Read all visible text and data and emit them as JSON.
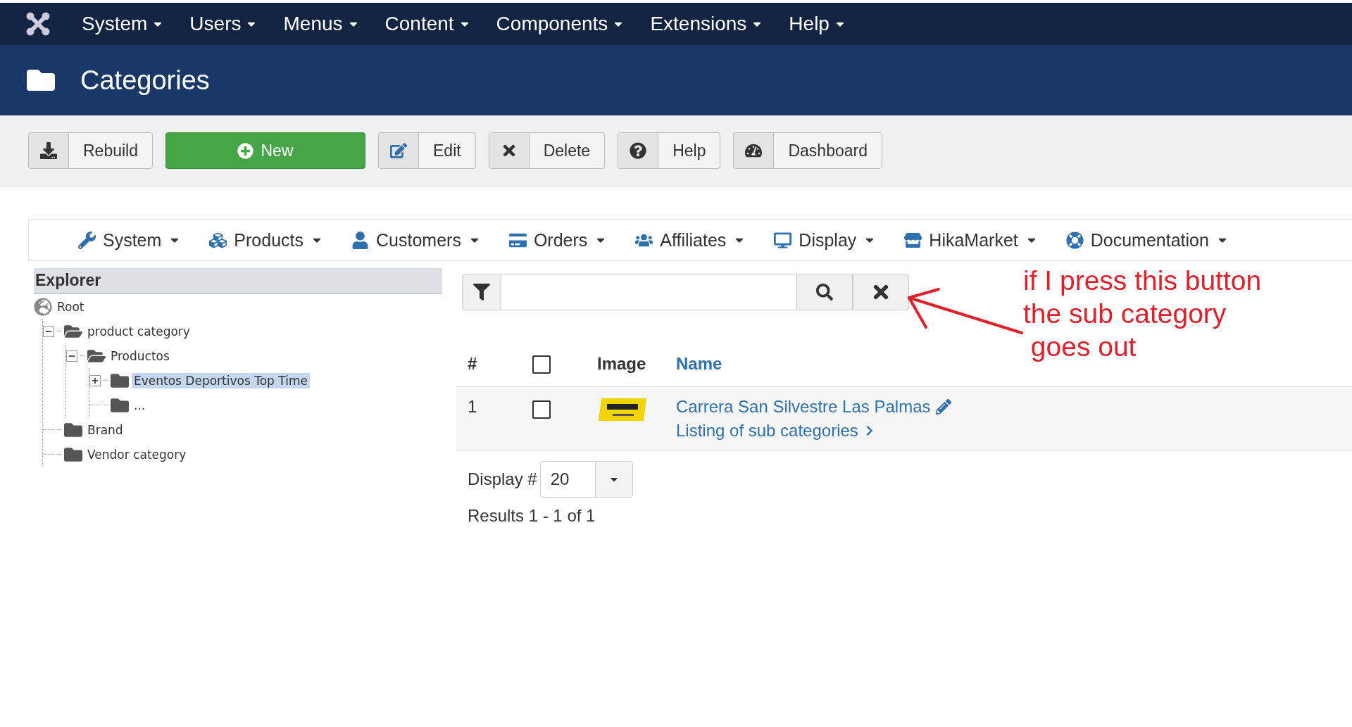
{
  "top_menu": {
    "items": [
      {
        "label": "System"
      },
      {
        "label": "Users"
      },
      {
        "label": "Menus"
      },
      {
        "label": "Content"
      },
      {
        "label": "Components"
      },
      {
        "label": "Extensions"
      },
      {
        "label": "Help"
      }
    ]
  },
  "header": {
    "title": "Categories"
  },
  "toolbar": {
    "buttons": [
      {
        "label": "Rebuild",
        "kind": "rebuild"
      },
      {
        "label": "New",
        "kind": "new"
      },
      {
        "label": "Edit",
        "kind": "edit"
      },
      {
        "label": "Delete",
        "kind": "delete"
      },
      {
        "label": "Help",
        "kind": "help"
      },
      {
        "label": "Dashboard",
        "kind": "dashboard"
      }
    ]
  },
  "component_menu": {
    "items": [
      {
        "label": "System",
        "kind": "wrench"
      },
      {
        "label": "Products",
        "kind": "cubes"
      },
      {
        "label": "Customers",
        "kind": "user"
      },
      {
        "label": "Orders",
        "kind": "card"
      },
      {
        "label": "Affiliates",
        "kind": "users"
      },
      {
        "label": "Display",
        "kind": "desktop"
      },
      {
        "label": "HikaMarket",
        "kind": "store"
      },
      {
        "label": "Documentation",
        "kind": "lifering"
      }
    ]
  },
  "explorer": {
    "title": "Explorer",
    "tree": [
      {
        "label": "Root",
        "kind": "root",
        "selected": false,
        "children": [
          {
            "label": "product category",
            "kind": "folder",
            "selected": false,
            "expanded": true,
            "children": [
              {
                "label": "Productos",
                "kind": "folder",
                "selected": false,
                "expanded": true,
                "children": [
                  {
                    "label": "Eventos Deportivos Top Time",
                    "kind": "folder",
                    "selected": true,
                    "expanded": false
                  },
                  {
                    "label": "...",
                    "kind": "folder",
                    "selected": false
                  }
                ]
              }
            ]
          },
          {
            "label": "Brand",
            "kind": "folder",
            "selected": false
          },
          {
            "label": "Vendor category",
            "kind": "folder",
            "selected": false
          }
        ]
      }
    ]
  },
  "table": {
    "columns": [
      {
        "kind": "number",
        "label": "#"
      },
      {
        "kind": "checkbox",
        "checked": false
      },
      {
        "kind": "text",
        "label": "Image"
      },
      {
        "kind": "link",
        "label": "Name"
      }
    ],
    "rows": [
      {
        "number": "1",
        "checked": false,
        "name": "Carrera San Silvestre Las Palmas",
        "sub_link": "Listing of sub categories"
      }
    ]
  },
  "pagination": {
    "display_label": "Display #",
    "value": "20",
    "results": "Results 1 - 1 of 1"
  },
  "annotation": {
    "lines": [
      "if I press this button",
      "the sub category",
      " goes out"
    ]
  }
}
